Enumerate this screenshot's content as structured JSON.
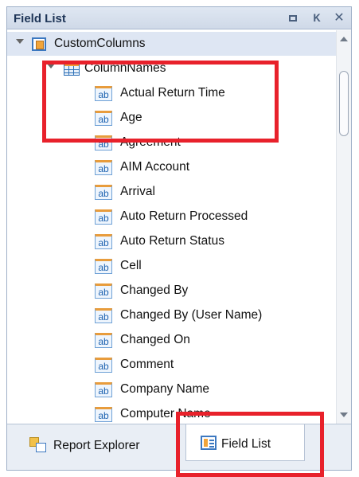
{
  "panel": {
    "title": "Field List",
    "buttons": {
      "restore_icon": "restore-window-icon",
      "pin_icon": "pin-icon",
      "close_icon": "close-icon"
    }
  },
  "tree": {
    "root": {
      "label": "CustomColumns",
      "icon": "data-source-icon"
    },
    "table": {
      "label": "ColumnNames",
      "icon": "table-icon"
    },
    "fields": [
      "Actual Return Time",
      "Age",
      "Agreement",
      "AIM Account",
      "Arrival",
      "Auto Return Processed",
      "Auto Return Status",
      "Cell",
      "Changed By",
      "Changed By (User Name)",
      "Changed On",
      "Comment",
      "Company Name",
      "Computer Name"
    ],
    "field_icon": "text-field-ab-icon"
  },
  "tabs": [
    {
      "label": "Report Explorer",
      "icon": "report-explorer-icon",
      "active": false
    },
    {
      "label": "Field List",
      "icon": "field-list-icon",
      "active": true
    }
  ],
  "colors": {
    "highlight": "#e8212b",
    "selection": "#dee6f3",
    "header": "#cfd9e8"
  }
}
